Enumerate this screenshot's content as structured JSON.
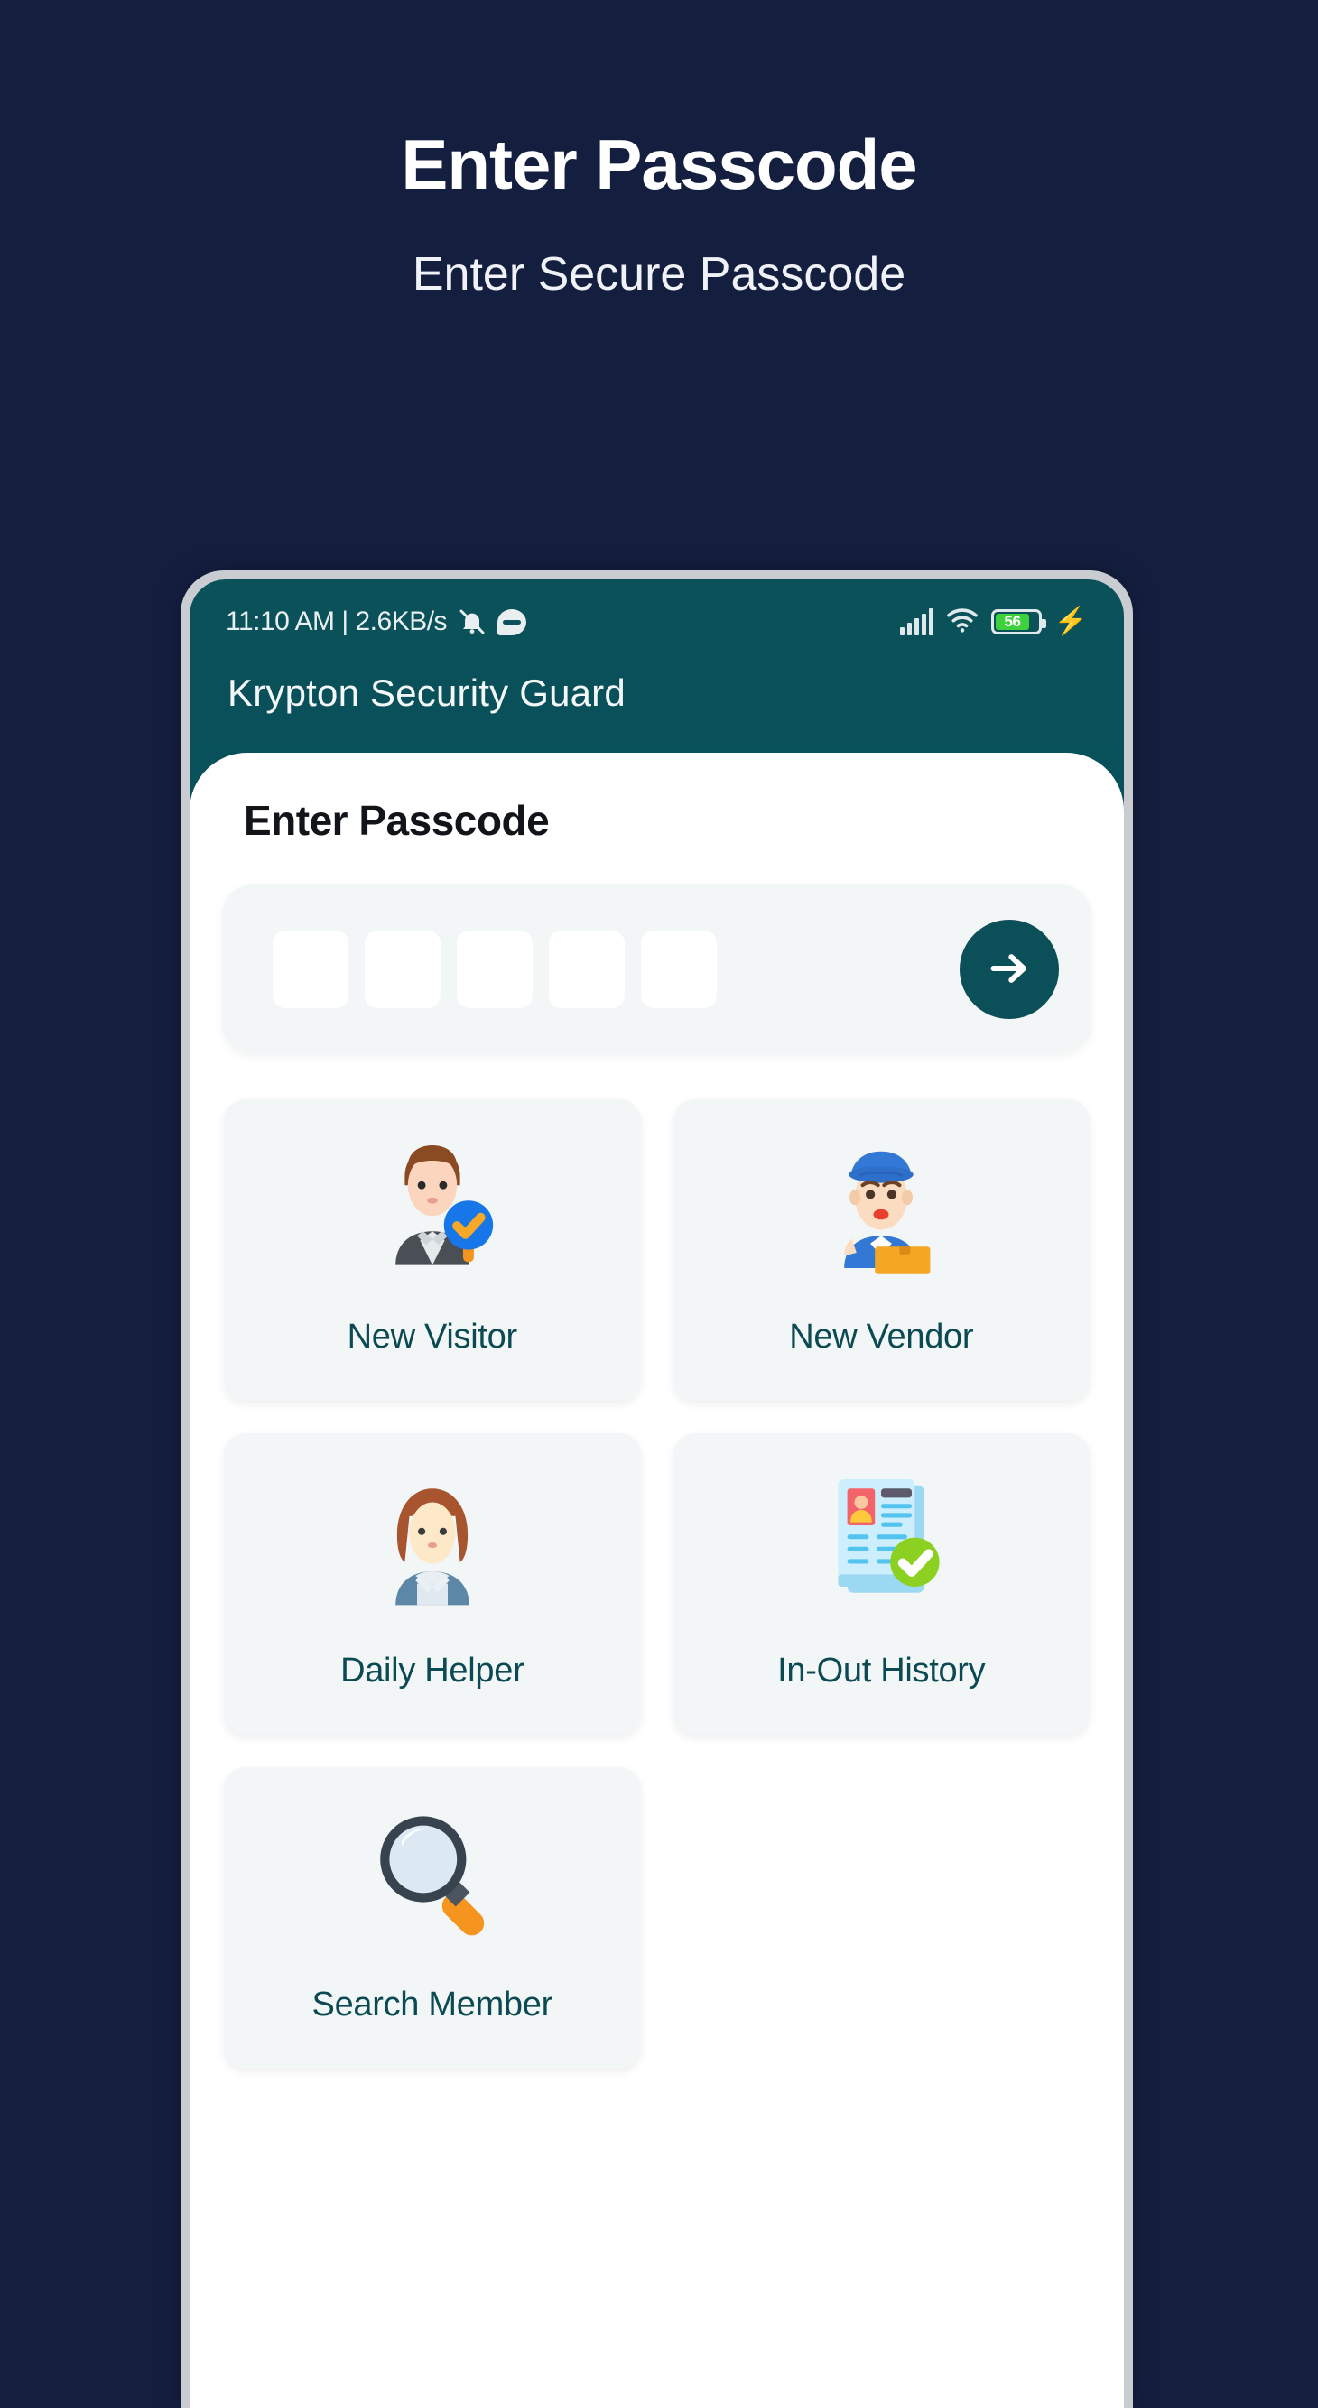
{
  "promo": {
    "title": "Enter Passcode",
    "subtitle": "Enter Secure Passcode"
  },
  "phone": {
    "status_bar": {
      "left_text": "11:10 AM | 2.6KB/s",
      "mute_icon": "mute-bell-icon",
      "chat_icon": "chat-bubble-icon",
      "signal_icon": "cellular-signal-icon",
      "wifi_icon": "wifi-icon",
      "battery_level": "56",
      "charging_icon": "charging-bolt-icon"
    },
    "app_bar": {
      "title": "Krypton Security Guard"
    },
    "sheet": {
      "title": "Enter Passcode",
      "passcode": {
        "digit_count": 5,
        "values": [
          "",
          "",
          "",
          "",
          ""
        ],
        "submit_icon": "arrow-right-icon"
      },
      "tiles": [
        {
          "label": "New Visitor",
          "icon": "verified-visitor-icon"
        },
        {
          "label": "New Vendor",
          "icon": "delivery-vendor-icon"
        },
        {
          "label": "Daily Helper",
          "icon": "housekeeper-icon"
        },
        {
          "label": "In-Out History",
          "icon": "id-document-check-icon"
        },
        {
          "label": "Search Member",
          "icon": "magnifier-icon"
        }
      ]
    }
  },
  "colors": {
    "page_background": "#141f40",
    "app_header": "#0a5159",
    "accent": "#0b4f58",
    "tile_background": "#f2f6f6",
    "tile_label": "#0c4a53",
    "battery_fill": "#3dd13d"
  }
}
